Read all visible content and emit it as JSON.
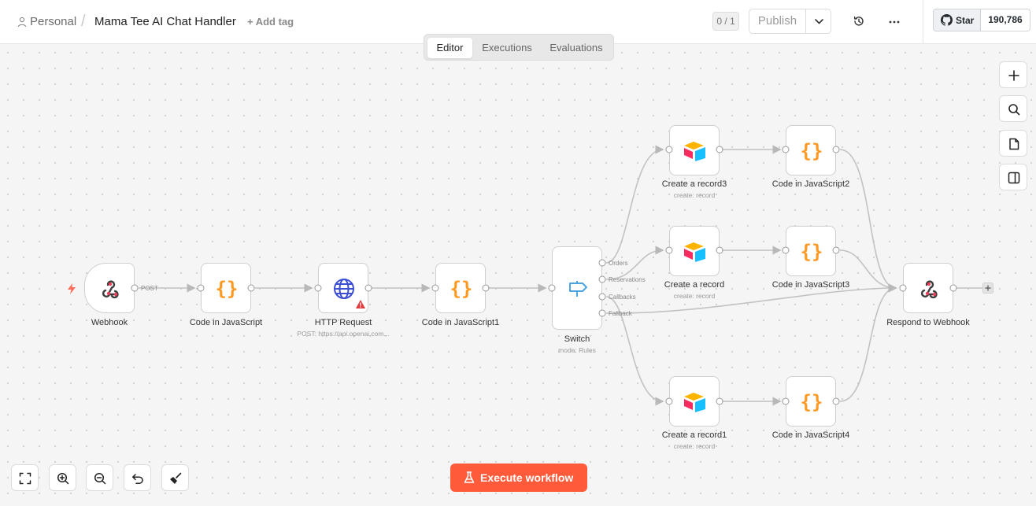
{
  "header": {
    "breadcrumb_personal": "Personal",
    "breadcrumb_separator": "/",
    "workflow_title": "Mama Tee AI Chat Handler",
    "add_tag": "+ Add tag",
    "counter": "0 / 1",
    "publish_label": "Publish",
    "github_star_label": "Star",
    "github_star_count": "190,786"
  },
  "tabs": {
    "editor": "Editor",
    "executions": "Executions",
    "evaluations": "Evaluations",
    "active": "Editor"
  },
  "nodes": {
    "webhook": {
      "label": "Webhook",
      "port_label": "POST"
    },
    "code_js": {
      "label": "Code in JavaScript"
    },
    "http_request": {
      "label": "HTTP Request",
      "subtitle": "POST: https://api.openai.com..."
    },
    "code_js1": {
      "label": "Code in JavaScript1"
    },
    "switch": {
      "label": "Switch",
      "subtitle": "mode: Rules",
      "outputs": [
        "Orders",
        "Reservations",
        "Callbacks",
        "Fallback"
      ]
    },
    "create_record3": {
      "label": "Create a record3",
      "subtitle": "create: record"
    },
    "create_record": {
      "label": "Create a record",
      "subtitle": "create: record"
    },
    "create_record1": {
      "label": "Create a record1",
      "subtitle": "create: record"
    },
    "code_js2": {
      "label": "Code in JavaScript2"
    },
    "code_js3": {
      "label": "Code in JavaScript3"
    },
    "code_js4": {
      "label": "Code in JavaScript4"
    },
    "respond_webhook": {
      "label": "Respond to Webhook"
    }
  },
  "actions": {
    "execute_label": "Execute workflow"
  },
  "colors": {
    "accent": "#ff5a3a",
    "code_orange": "#ff9922",
    "http_blue": "#3b4ed4",
    "switch_blue": "#4ba3e0",
    "warning_red": "#e5383b"
  },
  "icons": {
    "webhook": "webhook-icon",
    "code": "curly-braces-icon",
    "http": "globe-icon",
    "switch": "signpost-icon",
    "airtable": "airtable-icon"
  }
}
